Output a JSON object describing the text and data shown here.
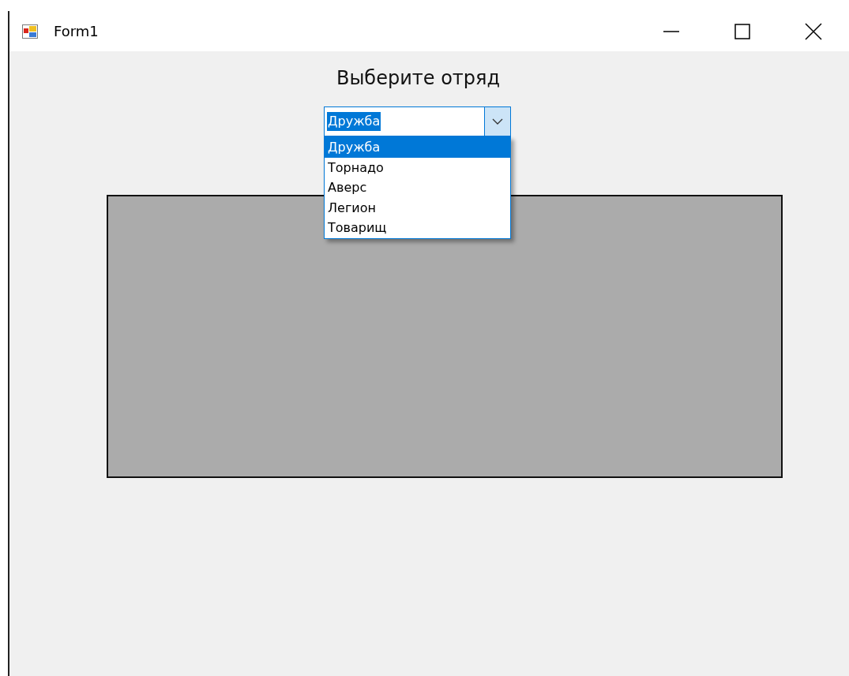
{
  "window": {
    "title": "Form1"
  },
  "heading": "Выберите отряд",
  "combo": {
    "value": "Дружба",
    "expanded": true,
    "options": [
      {
        "label": "Дружба",
        "selected": true
      },
      {
        "label": "Торнадо",
        "selected": false
      },
      {
        "label": "Аверс",
        "selected": false
      },
      {
        "label": "Легион",
        "selected": false
      },
      {
        "label": "Товарищ",
        "selected": false
      }
    ]
  }
}
